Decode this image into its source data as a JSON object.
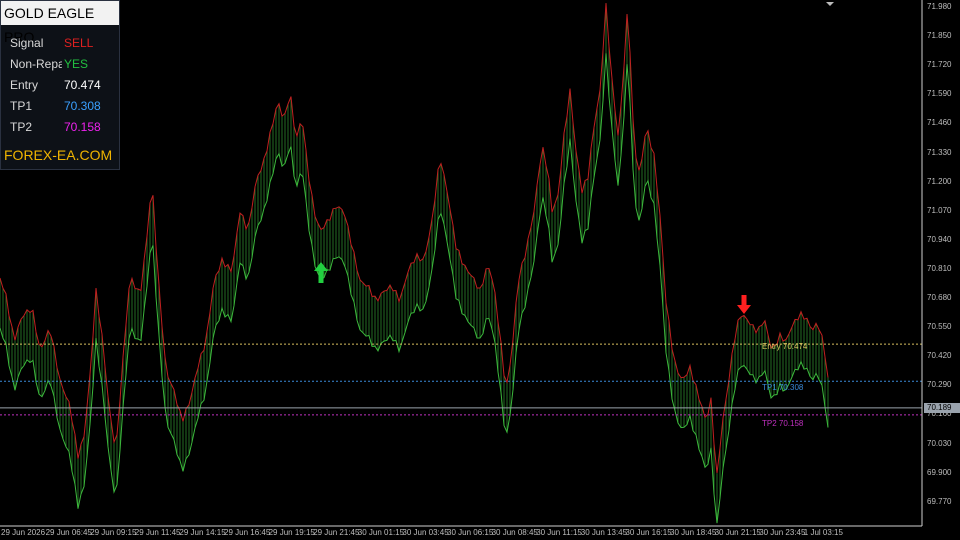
{
  "panel": {
    "title": "GOLD EAGLE PRO",
    "rows": [
      {
        "label": "Signal",
        "value": "SELL",
        "color": "#e02020"
      },
      {
        "label": "Non-Repaint",
        "value": "YES",
        "color": "#22c040"
      },
      {
        "label": "Entry",
        "value": "70.474",
        "color": "#ffffff"
      },
      {
        "label": "TP1",
        "value": "70.308",
        "color": "#3aa0ff"
      },
      {
        "label": "TP2",
        "value": "70.158",
        "color": "#ee22ee"
      }
    ],
    "brand": "FOREX-EA.COM"
  },
  "price_axis": [
    "71.980",
    "71.850",
    "71.720",
    "71.590",
    "71.460",
    "71.330",
    "71.200",
    "71.070",
    "70.940",
    "70.810",
    "70.680",
    "70.550",
    "70.420",
    "70.290",
    "70.160",
    "70.030",
    "69.900",
    "69.770"
  ],
  "time_axis": [
    "29 Jun 2026",
    "29 Jun 06:45",
    "29 Jun 09:15",
    "29 Jun 11:45",
    "29 Jun 14:15",
    "29 Jun 16:45",
    "29 Jun 19:15",
    "29 Jun 21:45",
    "30 Jun 01:15",
    "30 Jun 03:45",
    "30 Jun 06:15",
    "30 Jun 08:45",
    "30 Jun 11:15",
    "30 Jun 13:45",
    "30 Jun 16:15",
    "30 Jun 18:45",
    "30 Jun 21:15",
    "30 Jun 23:45",
    "1 Jul 03:15"
  ],
  "levels": {
    "entry": {
      "label": "Entry 70.474",
      "price": 70.474,
      "color": "#d8c060"
    },
    "tp1": {
      "label": "TP1 70.308",
      "price": 70.308,
      "color": "#3a8ad8"
    },
    "tp2": {
      "label": "TP2 70.158",
      "price": 70.158,
      "color": "#c030c0"
    },
    "current": {
      "label": "70.189",
      "price": 70.189
    }
  },
  "signals": [
    {
      "type": "buy",
      "name": "buy-arrow-icon",
      "color": "#22d040"
    },
    {
      "type": "sell",
      "name": "sell-arrow-icon",
      "color": "#ff2020"
    }
  ],
  "colors": {
    "up": "#3cb83c",
    "down": "#c02020",
    "grid": "#222"
  }
}
